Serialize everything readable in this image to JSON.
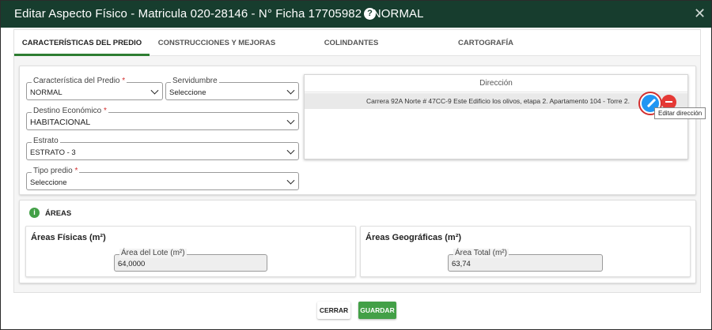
{
  "window": {
    "title": "Editar Aspecto Físico - Matricula 020-28146 - N° Ficha 17705982 - NORMAL",
    "help_glyph": "?",
    "close_glyph": "✕"
  },
  "tabs": [
    {
      "label": "CARACTERÍSTICAS DEL PREDIO",
      "active": true
    },
    {
      "label": "CONSTRUCCIONES Y MEJORAS",
      "active": false
    },
    {
      "label": "COLINDANTES",
      "active": false
    },
    {
      "label": "CARTOGRAFÍA",
      "active": false
    }
  ],
  "form": {
    "caracteristica": {
      "label": "Característica del Predio",
      "required": "*",
      "value": "NORMAL"
    },
    "servidumbre": {
      "label": "Servidumbre",
      "value": "Seleccione"
    },
    "destino": {
      "label": "Destino Económico",
      "required": "*",
      "value": "HABITACIONAL"
    },
    "estrato": {
      "label": "Estrato",
      "value": "ESTRATO - 3"
    },
    "tipo_predio": {
      "label": "Tipo predio",
      "required": "*",
      "value": "Seleccione"
    }
  },
  "direccion": {
    "header": "Dirección",
    "rows": [
      {
        "text": "Carrera 92A Norte # 47CC-9 Este Edificio los olivos, etapa 2. Apartamento 104 - Torre 2."
      }
    ],
    "edit_tooltip": "Editar dirección"
  },
  "areas": {
    "title": "ÁREAS",
    "icon_glyph": "i",
    "fisicas": {
      "title": "Áreas Físicas (m²)",
      "field_label": "Área del Lote (m²)",
      "value": "64,0000"
    },
    "geograficas": {
      "title": "Áreas Geográficas (m²)",
      "field_label": "Área Total (m²)",
      "value": "63,74"
    }
  },
  "footer": {
    "cerrar_label": "CERRAR",
    "guardar_label": "GUARDAR"
  },
  "colors": {
    "titlebar": "#173d2e",
    "accent_green": "#43a047",
    "edit_blue": "#2196f3",
    "remove_red": "#e53935"
  },
  "icons": [
    "help-icon",
    "close-icon",
    "chevron-down-icon",
    "pencil-icon",
    "minus-icon",
    "info-icon"
  ]
}
